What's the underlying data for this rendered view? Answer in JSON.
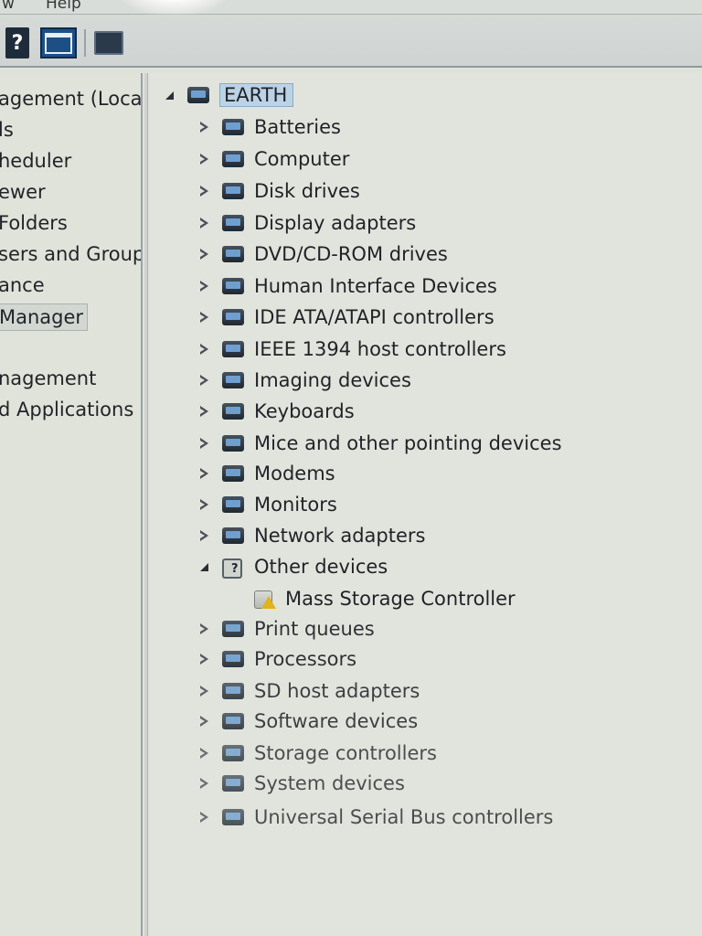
{
  "menubar": {
    "view": "w",
    "help": "Help"
  },
  "toolbar": {
    "help_icon": "help-icon",
    "view_icon": "show-hide-console-tree-icon",
    "scan_icon": "scan-hardware-icon"
  },
  "left_pane": {
    "items": [
      {
        "label": "agement (Local"
      },
      {
        "label": "ls"
      },
      {
        "label": "heduler"
      },
      {
        "label": "ewer"
      },
      {
        "label": "Folders"
      },
      {
        "label": "sers and Groups"
      },
      {
        "label": "ance"
      },
      {
        "label": "Manager"
      },
      {
        "label": "nagement"
      },
      {
        "label": "d Applications"
      }
    ]
  },
  "tree": {
    "root": "EARTH",
    "items": [
      {
        "label": "Batteries",
        "icon": "battery-icon",
        "state": "collapsed"
      },
      {
        "label": "Computer",
        "icon": "computer-icon",
        "state": "collapsed"
      },
      {
        "label": "Disk drives",
        "icon": "disk-drive-icon",
        "state": "collapsed"
      },
      {
        "label": "Display adapters",
        "icon": "display-adapter-icon",
        "state": "collapsed"
      },
      {
        "label": "DVD/CD-ROM drives",
        "icon": "dvd-drive-icon",
        "state": "collapsed"
      },
      {
        "label": "Human Interface Devices",
        "icon": "hid-icon",
        "state": "collapsed"
      },
      {
        "label": "IDE ATA/ATAPI controllers",
        "icon": "ide-controller-icon",
        "state": "collapsed"
      },
      {
        "label": "IEEE 1394 host controllers",
        "icon": "firewire-icon",
        "state": "collapsed"
      },
      {
        "label": "Imaging devices",
        "icon": "camera-icon",
        "state": "collapsed"
      },
      {
        "label": "Keyboards",
        "icon": "keyboard-icon",
        "state": "collapsed"
      },
      {
        "label": "Mice and other pointing devices",
        "icon": "mouse-icon",
        "state": "collapsed"
      },
      {
        "label": "Modems",
        "icon": "modem-icon",
        "state": "collapsed"
      },
      {
        "label": "Monitors",
        "icon": "monitor-icon",
        "state": "collapsed"
      },
      {
        "label": "Network adapters",
        "icon": "network-adapter-icon",
        "state": "collapsed"
      },
      {
        "label": "Other devices",
        "icon": "unknown-device-icon",
        "state": "expanded"
      },
      {
        "label": "Mass Storage Controller",
        "icon": "warning-device-icon",
        "state": "child"
      },
      {
        "label": "Print queues",
        "icon": "printer-icon",
        "state": "collapsed"
      },
      {
        "label": "Processors",
        "icon": "processor-icon",
        "state": "collapsed"
      },
      {
        "label": "SD host adapters",
        "icon": "sd-card-icon",
        "state": "collapsed"
      },
      {
        "label": "Software devices",
        "icon": "software-device-icon",
        "state": "collapsed"
      },
      {
        "label": "Storage controllers",
        "icon": "storage-controller-icon",
        "state": "collapsed"
      },
      {
        "label": "System devices",
        "icon": "system-device-icon",
        "state": "collapsed"
      },
      {
        "label": "Universal Serial Bus controllers",
        "icon": "usb-icon",
        "state": "collapsed"
      }
    ]
  }
}
